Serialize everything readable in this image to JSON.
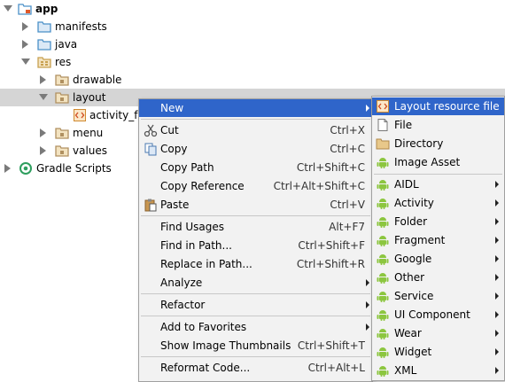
{
  "tree": {
    "app": "app",
    "manifests": "manifests",
    "java": "java",
    "res": "res",
    "drawable": "drawable",
    "layout": "layout",
    "activity_file": "activity_fra",
    "menu": "menu",
    "values": "values",
    "gradle_scripts": "Gradle Scripts"
  },
  "context_menu": {
    "new": "New",
    "cut": "Cut",
    "cut_sc": "Ctrl+X",
    "copy": "Copy",
    "copy_sc": "Ctrl+C",
    "copy_path": "Copy Path",
    "copy_path_sc": "Ctrl+Shift+C",
    "copy_reference": "Copy Reference",
    "copy_reference_sc": "Ctrl+Alt+Shift+C",
    "paste": "Paste",
    "paste_sc": "Ctrl+V",
    "find_usages": "Find Usages",
    "find_usages_sc": "Alt+F7",
    "find_in_path": "Find in Path...",
    "find_in_path_sc": "Ctrl+Shift+F",
    "replace_in_path": "Replace in Path...",
    "replace_in_path_sc": "Ctrl+Shift+R",
    "analyze": "Analyze",
    "refactor": "Refactor",
    "add_to_favorites": "Add to Favorites",
    "show_image_thumbnails": "Show Image Thumbnails",
    "show_image_thumbnails_sc": "Ctrl+Shift+T",
    "reformat_code": "Reformat Code...",
    "reformat_code_sc": "Ctrl+Alt+L"
  },
  "submenu": {
    "layout_resource_file": "Layout resource file",
    "file": "File",
    "directory": "Directory",
    "image_asset": "Image Asset",
    "aidl": "AIDL",
    "activity": "Activity",
    "folder": "Folder",
    "fragment": "Fragment",
    "google": "Google",
    "other": "Other",
    "service": "Service",
    "ui_component": "UI Component",
    "wear": "Wear",
    "widget": "Widget",
    "xml": "XML"
  },
  "colors": {
    "highlight": "#2f65ca",
    "android_green": "#8cc63f",
    "folder_blue": "#4a90c8",
    "folder_tan": "#c8a050"
  }
}
